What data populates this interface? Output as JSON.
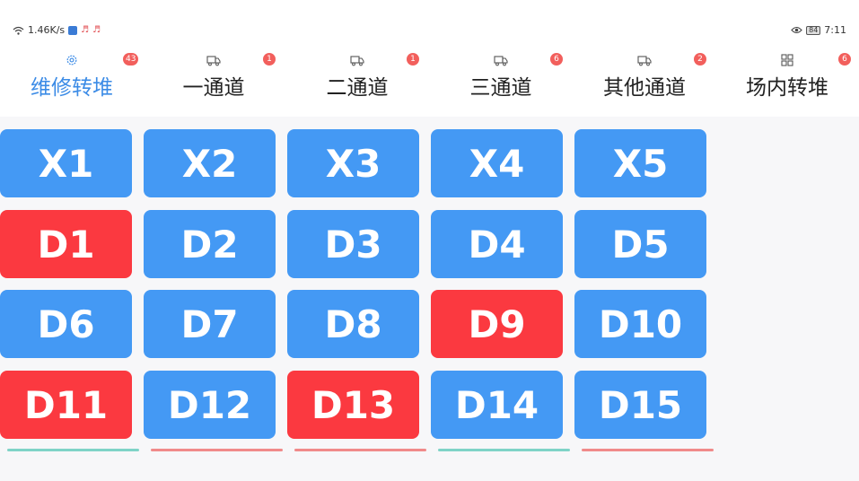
{
  "status_bar": {
    "net_speed": "1.46K/s",
    "battery": "84",
    "time": "7:11"
  },
  "tabs": [
    {
      "label": "维修转堆",
      "icon": "gear-icon",
      "badge": "43",
      "active": true
    },
    {
      "label": "一通道",
      "icon": "truck-icon",
      "badge": "1",
      "active": false
    },
    {
      "label": "二通道",
      "icon": "truck-icon",
      "badge": "1",
      "active": false
    },
    {
      "label": "三通道",
      "icon": "truck-icon",
      "badge": "6",
      "active": false
    },
    {
      "label": "其他通道",
      "icon": "truck-icon",
      "badge": "2",
      "active": false
    },
    {
      "label": "场内转堆",
      "icon": "grid-icon",
      "badge": "6",
      "active": false
    }
  ],
  "bays": [
    {
      "label": "X1",
      "status": "blue"
    },
    {
      "label": "X2",
      "status": "blue"
    },
    {
      "label": "X3",
      "status": "blue"
    },
    {
      "label": "X4",
      "status": "blue"
    },
    {
      "label": "X5",
      "status": "blue"
    },
    {
      "label": "D1",
      "status": "red"
    },
    {
      "label": "D2",
      "status": "blue"
    },
    {
      "label": "D3",
      "status": "blue"
    },
    {
      "label": "D4",
      "status": "blue"
    },
    {
      "label": "D5",
      "status": "blue"
    },
    {
      "label": "D6",
      "status": "blue"
    },
    {
      "label": "D7",
      "status": "blue"
    },
    {
      "label": "D8",
      "status": "blue"
    },
    {
      "label": "D9",
      "status": "red"
    },
    {
      "label": "D10",
      "status": "blue"
    },
    {
      "label": "D11",
      "status": "red"
    },
    {
      "label": "D12",
      "status": "blue"
    },
    {
      "label": "D13",
      "status": "red"
    },
    {
      "label": "D14",
      "status": "blue"
    },
    {
      "label": "D15",
      "status": "blue"
    }
  ],
  "colors": {
    "blue": "#4499f4",
    "red": "#fb3940",
    "active_tab": "#3b8be6",
    "badge": "#f25f5c"
  }
}
